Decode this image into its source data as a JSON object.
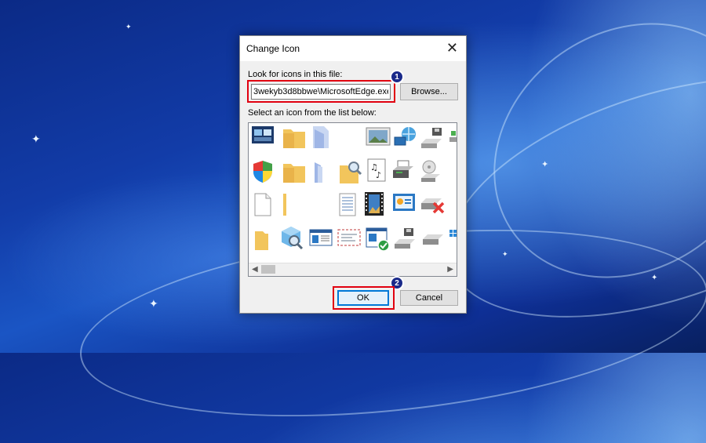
{
  "dialog": {
    "title": "Change Icon",
    "look_label": "Look for icons in this file:",
    "file_path": "3wekyb3d8bbwe\\MicrosoftEdge.exe",
    "browse_label": "Browse...",
    "select_label": "Select an icon from the list below:",
    "ok_label": "OK",
    "cancel_label": "Cancel"
  },
  "annotations": {
    "step1": "1",
    "step2": "2"
  },
  "icons": [
    "window-screens-icon",
    "folder-icon",
    "folder-doc-icon",
    "picture-frame-icon",
    "network-globe-icon",
    "drive-floppy-icon",
    "drive-icon",
    "shield-icon",
    "folder-icon",
    "folder-half-icon",
    "folder-search-icon",
    "music-document-icon",
    "printer-icon",
    "cd-drive-icon",
    "blank-document-icon",
    "folder-edge-icon",
    "text-document-icon",
    "video-film-icon",
    "control-panel-icon",
    "drive-x-icon",
    "",
    "folder-icon",
    "cube-search-icon",
    "window-list-icon",
    "envelope-icon",
    "window-check-icon",
    "floppy-drive-icon",
    "drive-icon"
  ],
  "colors": {
    "highlight": "#e10010",
    "badge": "#1a2a8a",
    "accent": "#0078d7"
  }
}
